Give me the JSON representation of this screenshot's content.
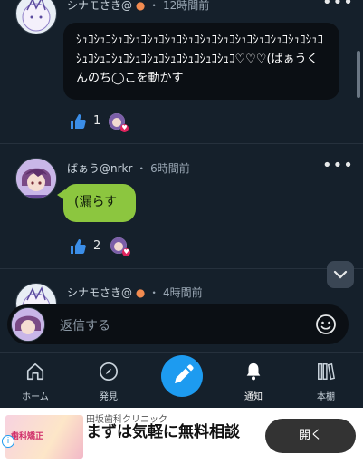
{
  "posts": [
    {
      "author": "シナモさき@",
      "time": "12時間前",
      "body": "ｼｭｺｼｭｺｼｭｺｼｭｺｼｭｺｼｭｺｼｭｺｼｭｺｼｭｺｼｭｺｼｭｺｼｭｺｼｭｺｼｭｺｼｭｺｼｭｺｼｭｺｼｭｺｼｭｺｼｭｺｼｭｺｼｭｺｼｭｺ♡♡♡(ばぁうくんのち◯こを動かす",
      "likes": "1"
    },
    {
      "author": "ばぁう@nrkr",
      "time": "6時間前",
      "body": "(漏らす",
      "likes": "2"
    },
    {
      "author": "シナモさき@",
      "time": "4時間前"
    }
  ],
  "meta_sep": "・",
  "more_label": "•••",
  "reply": {
    "placeholder": "返信する"
  },
  "nav": {
    "home": "ホーム",
    "discover": "発見",
    "notifications": "通知",
    "bookshelf": "本棚"
  },
  "ad": {
    "advertiser": "田坂歯科クリニック",
    "headline": "まずは気軽に無料相談",
    "cta": "開く",
    "thumb_text": "歯科矯正",
    "info": "i"
  },
  "colors": {
    "background": "#15202b",
    "accent": "#1d9bf0",
    "green_bubble": "#8cc63f",
    "heart": "#e0245e"
  }
}
